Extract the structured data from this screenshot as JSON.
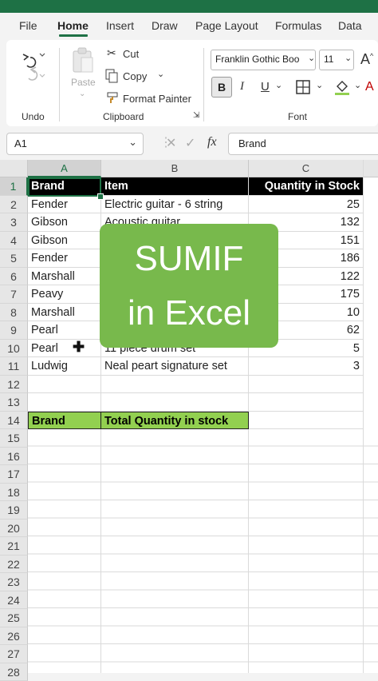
{
  "ribbon_tabs": [
    "File",
    "Home",
    "Insert",
    "Draw",
    "Page Layout",
    "Formulas",
    "Data"
  ],
  "active_tab": "Home",
  "clipboard": {
    "paste": "Paste",
    "cut": "Cut",
    "copy": "Copy",
    "format_painter": "Format Painter"
  },
  "groups": {
    "undo": "Undo",
    "clipboard": "Clipboard",
    "font": "Font"
  },
  "font": {
    "family": "Franklin Gothic Boo",
    "size": "11",
    "bold": "B",
    "italic": "I",
    "underline": "U"
  },
  "name_box": "A1",
  "formula_bar": "Brand",
  "fx": "fx",
  "columns": [
    "A",
    "B",
    "C"
  ],
  "row_numbers": [
    "1",
    "2",
    "3",
    "4",
    "5",
    "6",
    "7",
    "8",
    "9",
    "10",
    "11",
    "12",
    "13",
    "14",
    "15",
    "16",
    "17",
    "18",
    "19",
    "20",
    "21",
    "22",
    "23",
    "24",
    "25",
    "26",
    "27",
    "28"
  ],
  "header_row": {
    "a": "Brand",
    "b": "Item",
    "c": "Quantity in Stock"
  },
  "rows": [
    {
      "a": "Fender",
      "b": "Electric guitar - 6 string",
      "c": "25"
    },
    {
      "a": "Gibson",
      "b": "Acoustic guitar",
      "c": "132"
    },
    {
      "a": "Gibson",
      "b": "",
      "c": "151"
    },
    {
      "a": "Fender",
      "b": "",
      "c": "186"
    },
    {
      "a": "Marshall",
      "b": "",
      "c": "122"
    },
    {
      "a": "Peavy",
      "b": "",
      "c": "175"
    },
    {
      "a": "Marshall",
      "b": "",
      "c": "10"
    },
    {
      "a": "Pearl",
      "b": "",
      "c": "62"
    },
    {
      "a": "Pearl",
      "b": "11 piece drum set",
      "c": "5"
    },
    {
      "a": "Ludwig",
      "b": "Neal peart signature set",
      "c": "3"
    }
  ],
  "summary_header": {
    "a": "Brand",
    "b": "Total Quantity in stock"
  },
  "overlay": {
    "line1": "SUMIF",
    "line2": "in Excel"
  },
  "colors": {
    "excel_green": "#1e7145",
    "overlay_green": "#78b94c",
    "summary_green": "#92d050",
    "header_black": "#000000"
  }
}
